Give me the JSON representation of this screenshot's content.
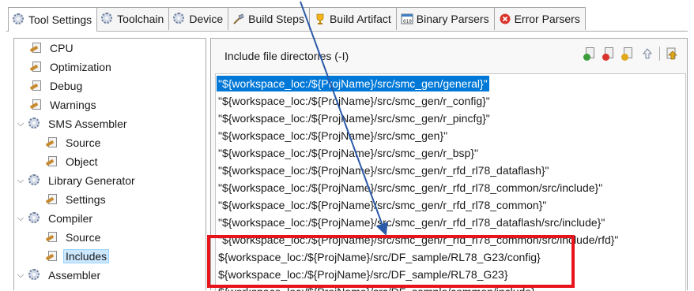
{
  "tabs": [
    {
      "label": "Tool Settings",
      "icon": "gear-icon",
      "active": true
    },
    {
      "label": "Toolchain",
      "icon": "gear-icon"
    },
    {
      "label": "Device",
      "icon": "gear-icon"
    },
    {
      "label": "Build Steps",
      "icon": "build-steps-icon"
    },
    {
      "label": "Build Artifact",
      "icon": "trophy-icon"
    },
    {
      "label": "Binary Parsers",
      "icon": "binary-icon"
    },
    {
      "label": "Error Parsers",
      "icon": "error-icon"
    }
  ],
  "tree": {
    "items": [
      {
        "label": "CPU",
        "icon": "tool-settings-icon"
      },
      {
        "label": "Optimization",
        "icon": "tool-settings-icon"
      },
      {
        "label": "Debug",
        "icon": "tool-settings-icon"
      },
      {
        "label": "Warnings",
        "icon": "tool-settings-icon"
      },
      {
        "label": "SMS Assembler",
        "icon": "gear-icon",
        "expanded": true
      },
      {
        "label": "Source",
        "icon": "tool-settings-icon"
      },
      {
        "label": "Object",
        "icon": "tool-settings-icon"
      },
      {
        "label": "Library Generator",
        "icon": "gear-icon",
        "expanded": true
      },
      {
        "label": "Settings",
        "icon": "tool-settings-icon"
      },
      {
        "label": "Compiler",
        "icon": "gear-icon",
        "expanded": true
      },
      {
        "label": "Source",
        "icon": "tool-settings-icon"
      },
      {
        "label": "Includes",
        "icon": "tool-settings-icon",
        "selected": true
      },
      {
        "label": "Assembler",
        "icon": "gear-icon",
        "expanded": true
      }
    ]
  },
  "panel": {
    "title": "Include file directories (-I)",
    "toolbar_icons": [
      "add-icon",
      "delete-icon",
      "edit-icon",
      "move-up-icon",
      "move-down-icon"
    ]
  },
  "include_dirs": [
    "\"${workspace_loc:/${ProjName}/src/smc_gen/general}\"",
    "\"${workspace_loc:/${ProjName}/src/smc_gen/r_config}\"",
    "\"${workspace_loc:/${ProjName}/src/smc_gen/r_pincfg}\"",
    "\"${workspace_loc:/${ProjName}/src/smc_gen}\"",
    "\"${workspace_loc:/${ProjName}/src/smc_gen/r_bsp}\"",
    "\"${workspace_loc:/${ProjName}/src/smc_gen/r_rfd_rl78_dataflash}\"",
    "\"${workspace_loc:/${ProjName}/src/smc_gen/r_rfd_rl78_common/src/include}\"",
    "\"${workspace_loc:/${ProjName}/src/smc_gen/r_rfd_rl78_common}\"",
    "\"${workspace_loc:/${ProjName}/src/smc_gen/r_rfd_rl78_dataflash/src/include}\"",
    "\"${workspace_loc:/${ProjName}/src/smc_gen/r_rfd_rl78_common/src/include/rfd}\"",
    "${workspace_loc:/${ProjName}/src/DF_sample/RL78_G23/config}",
    "${workspace_loc:/${ProjName}/src/DF_sample/RL78_G23}",
    "${workspace_loc:/${ProjName}/src/DF_sample/common/include}"
  ],
  "colors": {
    "highlight_box": "#e8141b",
    "arrow": "#2a5aa8",
    "selection": "#0078d7"
  }
}
